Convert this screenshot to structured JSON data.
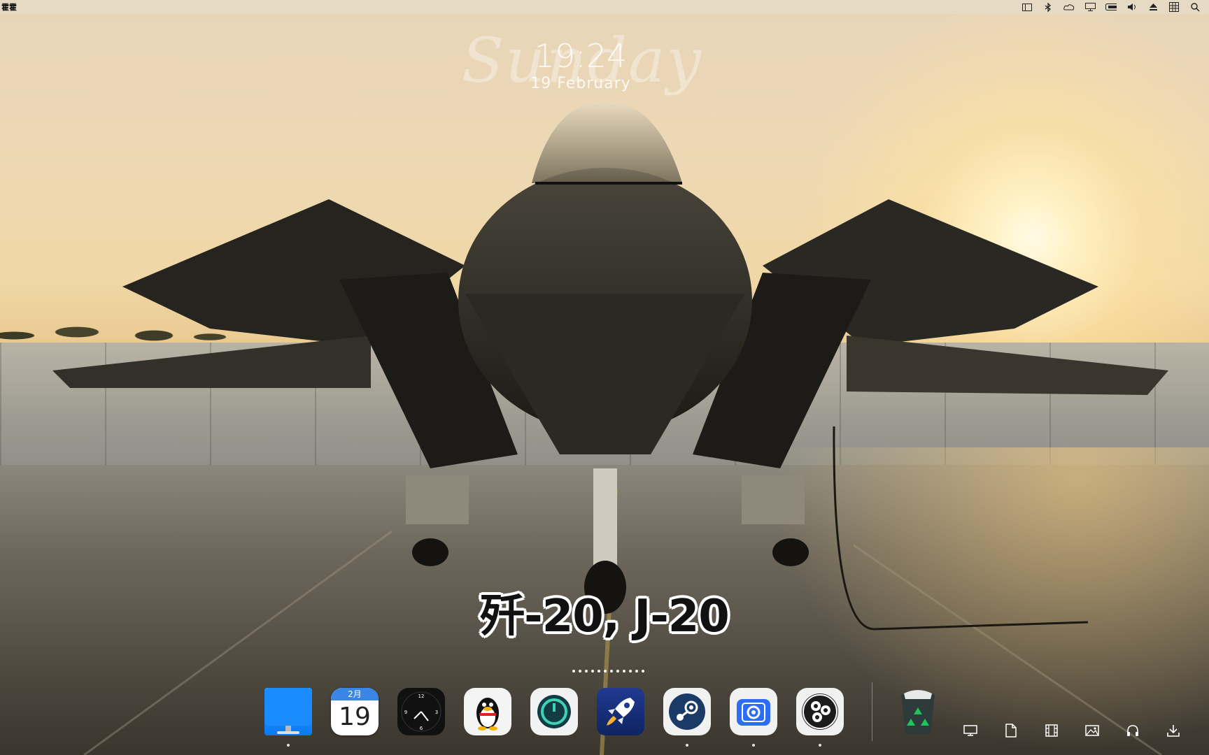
{
  "menubar": {
    "logo_text": "霍霍",
    "tray_icons": [
      "sidebar-icon",
      "bluetooth-icon",
      "cloud-icon",
      "display-icon",
      "keyboard-icon",
      "volume-icon",
      "eject-icon",
      "calendar-grid-icon",
      "search-icon"
    ]
  },
  "clock_widget": {
    "script_text": "Sunday",
    "time": "19:24",
    "date": "19 February"
  },
  "subtitle": "歼-20, J-20",
  "dock": {
    "items": [
      {
        "name": "finder",
        "label": "Finder",
        "running": true
      },
      {
        "name": "calendar",
        "label": "Calendar",
        "month": "2月",
        "day": "19",
        "running": false
      },
      {
        "name": "clock",
        "label": "Clock",
        "running": false
      },
      {
        "name": "qq",
        "label": "QQ",
        "running": false
      },
      {
        "name": "ring-app",
        "label": "App",
        "running": false
      },
      {
        "name": "rocket",
        "label": "Launchpad",
        "running": false
      },
      {
        "name": "steam",
        "label": "Steam",
        "running": true
      },
      {
        "name": "screenshot",
        "label": "Screenshot",
        "running": true
      },
      {
        "name": "obs",
        "label": "OBS",
        "running": true
      },
      {
        "name": "trash",
        "label": "Trash",
        "running": false
      }
    ],
    "page_dots": 12
  },
  "right_tray": [
    "desktop-icon",
    "document-icon",
    "film-icon",
    "image-icon",
    "headphones-icon",
    "download-icon"
  ],
  "colors": {
    "sky": "#edd8b4",
    "sun": "#fff8da",
    "jet": "#2d2b26",
    "dock_blue": "#0a79f0"
  }
}
